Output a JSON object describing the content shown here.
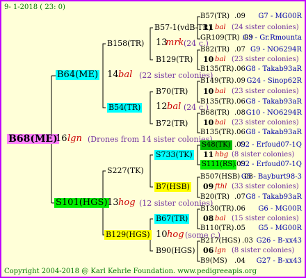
{
  "header": "9-  1-2018 ( 23:  0)",
  "footer": "Copyright 2004-2018 @ Karl Kehrle Foundation.   www.pedigreeapis.org",
  "root": {
    "name": "B68(ME)",
    "year": "16",
    "breeder": "lgn",
    "note": "(Drones from 14 sister colonies)"
  },
  "gen1": [
    {
      "name": "B64(ME)",
      "year": "14",
      "breeder": "bal",
      "note": "(22 sister colonies)"
    },
    {
      "name": "S101(HGS)",
      "year": "13",
      "breeder": "hog",
      "note": "(12 sister colonies)"
    }
  ],
  "gen2": [
    {
      "name": "B158(TR)"
    },
    {
      "name": "B54(TR)",
      "year": "12",
      "breeder": "bal",
      "note": "(24 c.)"
    },
    {
      "name": "S227(TK)"
    },
    {
      "name": "B129(HGS)",
      "year": "10",
      "breeder": "hog",
      "note": "(some c.)"
    }
  ],
  "gen3": [
    {
      "name": "B57-1(vdB-TR)",
      "year": "13",
      "breeder": "mrk",
      "note": "(24 c.)"
    },
    {
      "name": "B129(TR)"
    },
    {
      "name": "B70(TR)",
      "year": "12",
      "breeder": "bal",
      "note": "(24 c.)"
    },
    {
      "name": "B72(TR)"
    },
    {
      "name": "S733(TK)",
      "year": "12",
      "breeder": "hbg",
      "note": "(20 c.)"
    },
    {
      "name": "B7(HSB)"
    },
    {
      "name": "B67(TR)",
      "year": "10",
      "breeder": "hog",
      "note": "(some c.)"
    },
    {
      "name": "B90(HGS)"
    }
  ],
  "gen4": [
    {
      "name": "B57(TR)",
      "score": ".09",
      "ref": "G7 - MG00R"
    },
    {
      "year": "11",
      "breeder": "bal",
      "note": "(24 sister colonies)"
    },
    {
      "name": "GR109(TR)",
      "score": ".09",
      "ref": "G3 - Gr.Rmounta"
    },
    {
      "name": "B82(TR)",
      "score": ".07",
      "ref": "G9 - NO6294R"
    },
    {
      "year": "10",
      "breeder": "bal",
      "note": "(23 sister colonies)"
    },
    {
      "name": "B135(TR)",
      "score": ".06",
      "ref": "G8 - Takab93aR"
    },
    {
      "name": "B149(TR)",
      "score": ".09",
      "ref": "G24 - Sinop62R"
    },
    {
      "year": "10",
      "breeder": "bal",
      "note": "(23 sister colonies)"
    },
    {
      "name": "B135(TR)",
      "score": ".06",
      "ref": "G8 - Takab93aR"
    },
    {
      "name": "B68(TR)",
      "score": ".08",
      "ref": "G10 - NO6294R"
    },
    {
      "year": "10",
      "breeder": "bal",
      "note": "(23 sister colonies)"
    },
    {
      "name": "B135(TR)",
      "score": ".06",
      "ref": "G8 - Takab93aR"
    },
    {
      "name": "S48(TK)",
      "score": ".09",
      "ref": "G2 - Erfoud07-1Q"
    },
    {
      "year": "11",
      "breeder": "hbg",
      "note": "(8 sister colonies)"
    },
    {
      "name": "S111(RS)",
      "score": ".09",
      "ref": "G2 - Erfoud07-1Q"
    },
    {
      "name": "B507(HSB)",
      "score": ".08",
      "ref": "G5 - Bayburt98-3"
    },
    {
      "year": "09",
      "breeder": "fthl",
      "note": "(33 sister colonies)"
    },
    {
      "name": "B20(TR)",
      "score": ".07",
      "ref": "G8 - Takab93aR"
    },
    {
      "name": "B130(TR)",
      "score": ".06",
      "ref": "G6 - MG00R"
    },
    {
      "year": "08",
      "breeder": "bal",
      "note": "(15 sister colonies)"
    },
    {
      "name": "B110(TR)",
      "score": ".05",
      "ref": "G5 - MG00R"
    },
    {
      "name": "B217(HGS)",
      "score": ".03",
      "ref": "G26 - B-xx43"
    },
    {
      "year": "06",
      "breeder": "lgn",
      "note": "(8 sister colonies)"
    },
    {
      "name": "B9(MS)",
      "score": ".04",
      "ref": "G27 - B-xx43"
    }
  ]
}
